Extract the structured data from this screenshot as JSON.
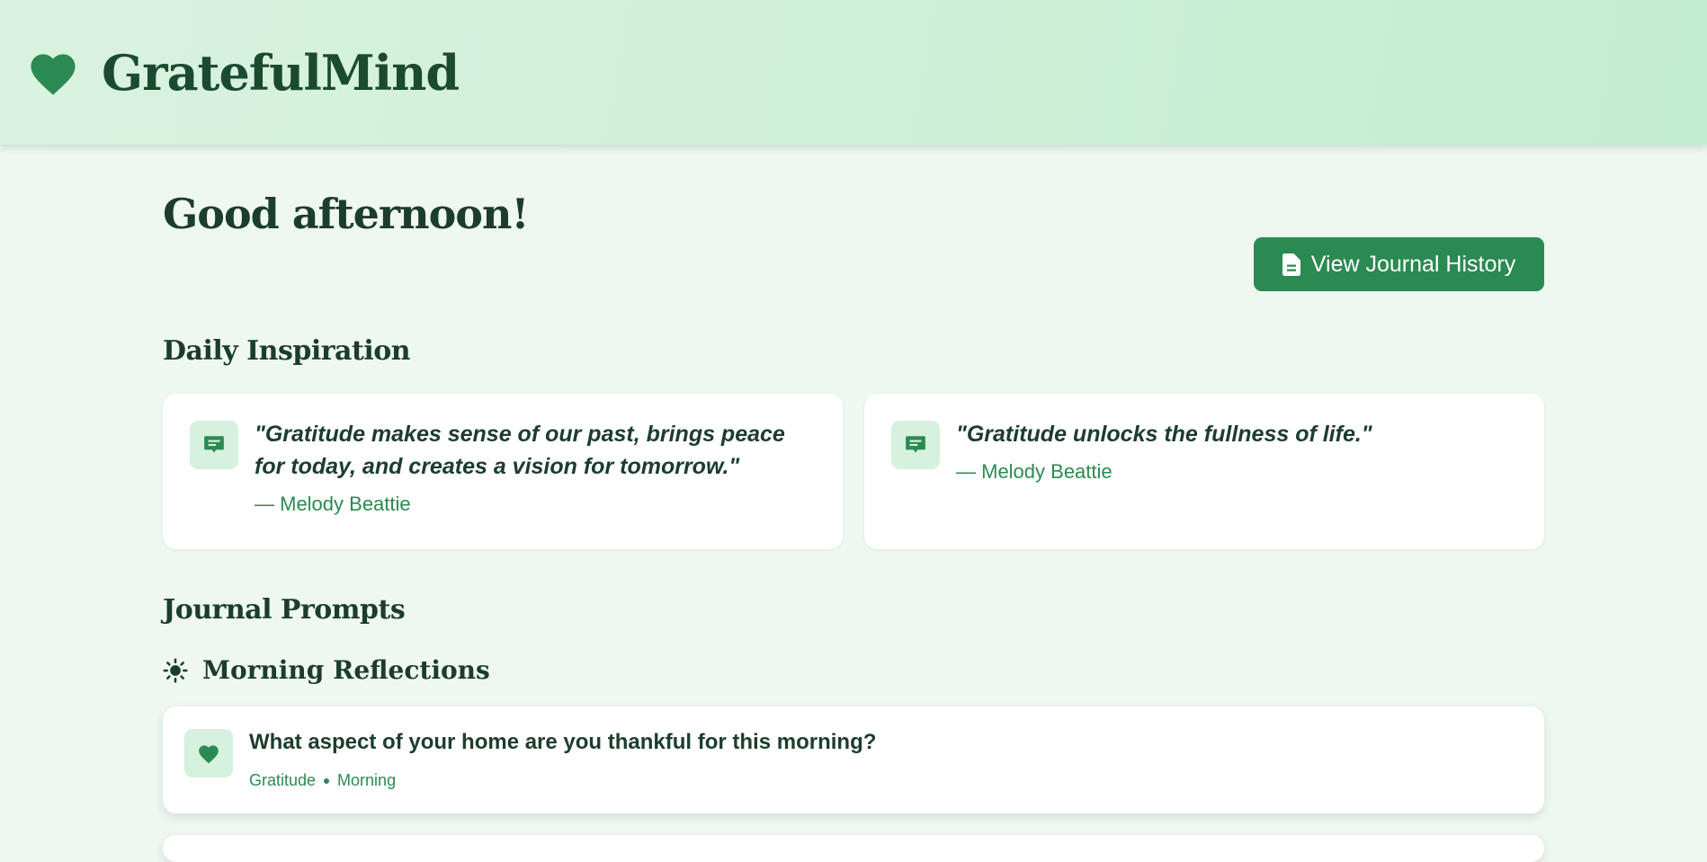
{
  "app": {
    "name": "GratefulMind",
    "logo_icon": "heart-icon"
  },
  "greeting": "Good afternoon!",
  "actions": {
    "history_label": "View Journal History",
    "history_icon": "document-icon"
  },
  "inspiration": {
    "title": "Daily Inspiration",
    "quotes": [
      {
        "text": "\"Gratitude makes sense of our past, brings peace for today, and creates a vision for tomorrow.\"",
        "author": "— Melody Beattie",
        "icon": "message-icon"
      },
      {
        "text": "\"Gratitude unlocks the fullness of life.\"",
        "author": "— Melody Beattie",
        "icon": "message-icon"
      }
    ]
  },
  "prompts": {
    "title": "Journal Prompts",
    "categories": [
      {
        "label": "Morning Reflections",
        "icon": "sun-icon",
        "items": [
          {
            "text": "What aspect of your home are you thankful for this morning?",
            "tags": [
              "Gratitude",
              "Morning"
            ],
            "icon": "heart-icon"
          }
        ]
      }
    ]
  },
  "colors": {
    "accent": "#2b8a51",
    "text": "#1c3d2c",
    "background": "#eef7f0",
    "header_bg": "#c4ecd0",
    "icon_bg": "#d6f1dd"
  }
}
